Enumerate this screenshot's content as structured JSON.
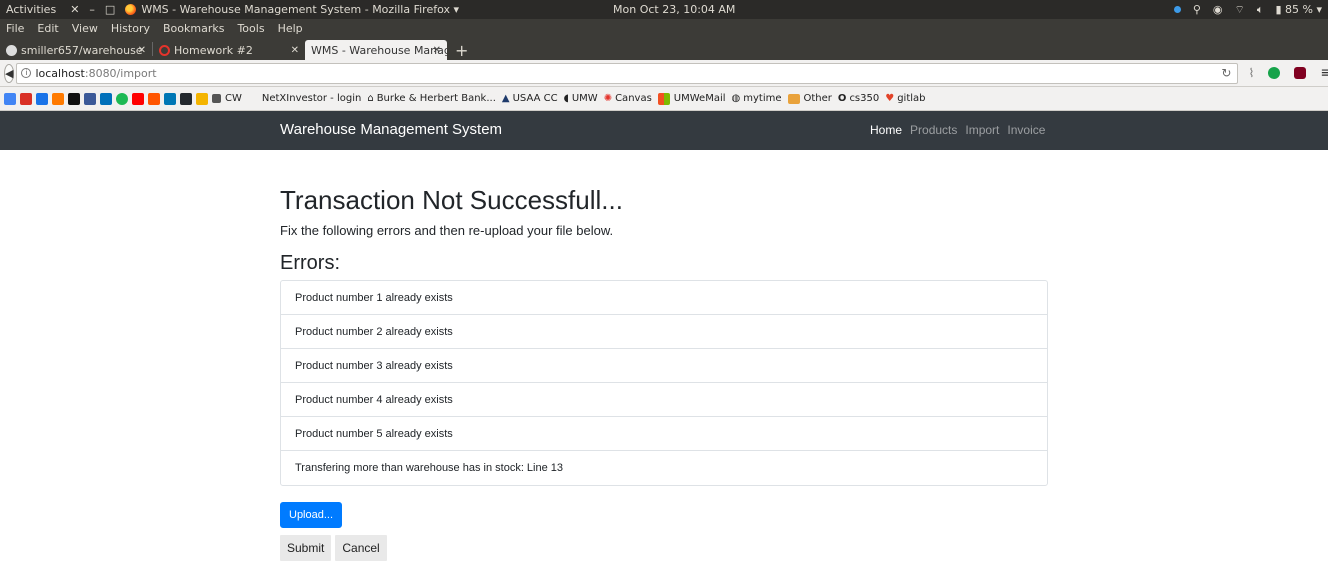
{
  "system_panel": {
    "activities": "Activities",
    "window_title": "WMS - Warehouse Management System - Mozilla Firefox ▾",
    "clock": "Mon Oct 23, 10:04 AM",
    "battery": "85 % ▾"
  },
  "menubar": [
    "File",
    "Edit",
    "View",
    "History",
    "Bookmarks",
    "Tools",
    "Help"
  ],
  "tabs": [
    {
      "title": "smiller657/warehouse",
      "icon": "github-icon"
    },
    {
      "title": "Homework #2",
      "icon": "canvas-icon"
    },
    {
      "title": "WMS - Warehouse Manage",
      "icon": "none"
    }
  ],
  "url": {
    "host": "localhost",
    "path": ":8080/import"
  },
  "bookmarks": [
    {
      "label": "CW",
      "color": "#555555"
    },
    {
      "label": "NetXInvestor - login",
      "color": ""
    },
    {
      "label": "Burke & Herbert Bank...",
      "color": "#333333"
    },
    {
      "label": "USAA CC",
      "color": "#1f3b6b"
    },
    {
      "label": "UMW",
      "color": "#555555"
    },
    {
      "label": "Canvas",
      "color": "#e4332b"
    },
    {
      "label": "UMWeMail",
      "color": "#f25022"
    },
    {
      "label": "mytime",
      "color": "#555555"
    },
    {
      "label": "Other",
      "color": "#e9a23b"
    },
    {
      "label": "cs350",
      "color": "#111111"
    },
    {
      "label": "gitlab",
      "color": "#e24329"
    }
  ],
  "app": {
    "brand": "Warehouse Management System",
    "nav": [
      "Home",
      "Products",
      "Import",
      "Invoice"
    ]
  },
  "page": {
    "title": "Transaction Not Successfull...",
    "subtitle": "Fix the following errors and then re-upload your file below.",
    "errors_heading": "Errors:",
    "errors": [
      "Product number 1 already exists",
      "Product number 2 already exists",
      "Product number 3 already exists",
      "Product number 4 already exists",
      "Product number 5 already exists",
      "Transfering more than warehouse has in stock: Line 13"
    ],
    "upload_label": "Upload...",
    "submit_label": "Submit",
    "cancel_label": "Cancel"
  },
  "colors": {
    "navbar_bg": "#343a40",
    "primary": "#007bff",
    "ubuntu_panel": "#2b2a28"
  }
}
